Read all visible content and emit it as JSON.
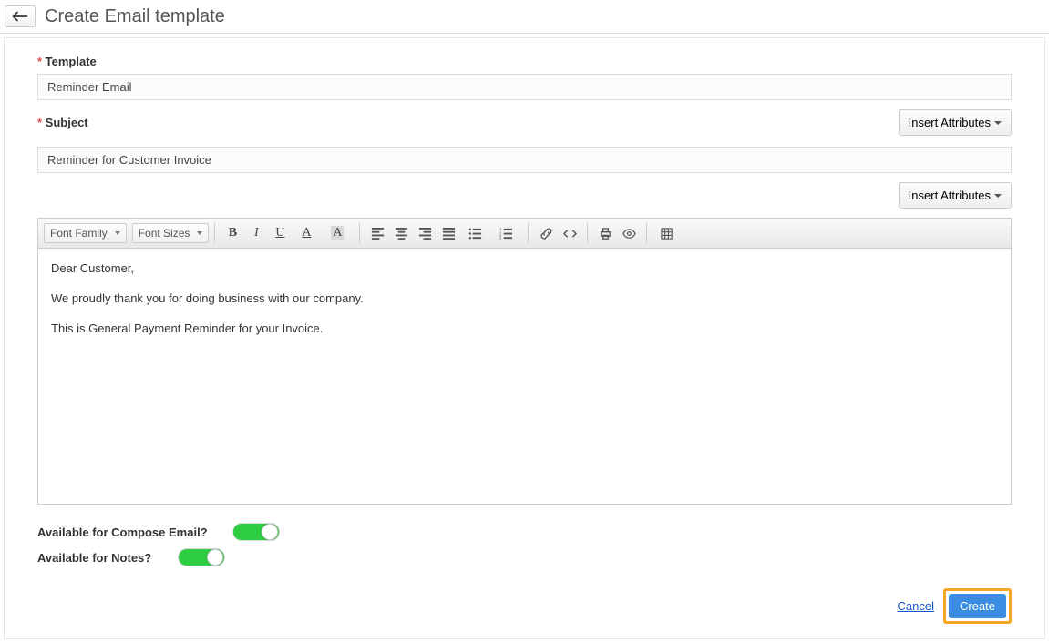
{
  "header": {
    "title": "Create Email template"
  },
  "form": {
    "template_label": "Template",
    "template_value": "Reminder Email",
    "subject_label": "Subject",
    "subject_value": "Reminder for Customer Invoice",
    "insert_attributes_label": "Insert Attributes"
  },
  "toolbar": {
    "font_family": "Font Family",
    "font_sizes": "Font Sizes"
  },
  "editor": {
    "para1": "Dear Customer,",
    "para2": "We proudly thank you for doing business with our company.",
    "para3": "This is General Payment Reminder for your Invoice."
  },
  "toggles": {
    "compose_label": "Available for Compose Email?",
    "notes_label": "Available for Notes?",
    "compose_on": true,
    "notes_on": true
  },
  "footer": {
    "cancel": "Cancel",
    "create": "Create"
  }
}
